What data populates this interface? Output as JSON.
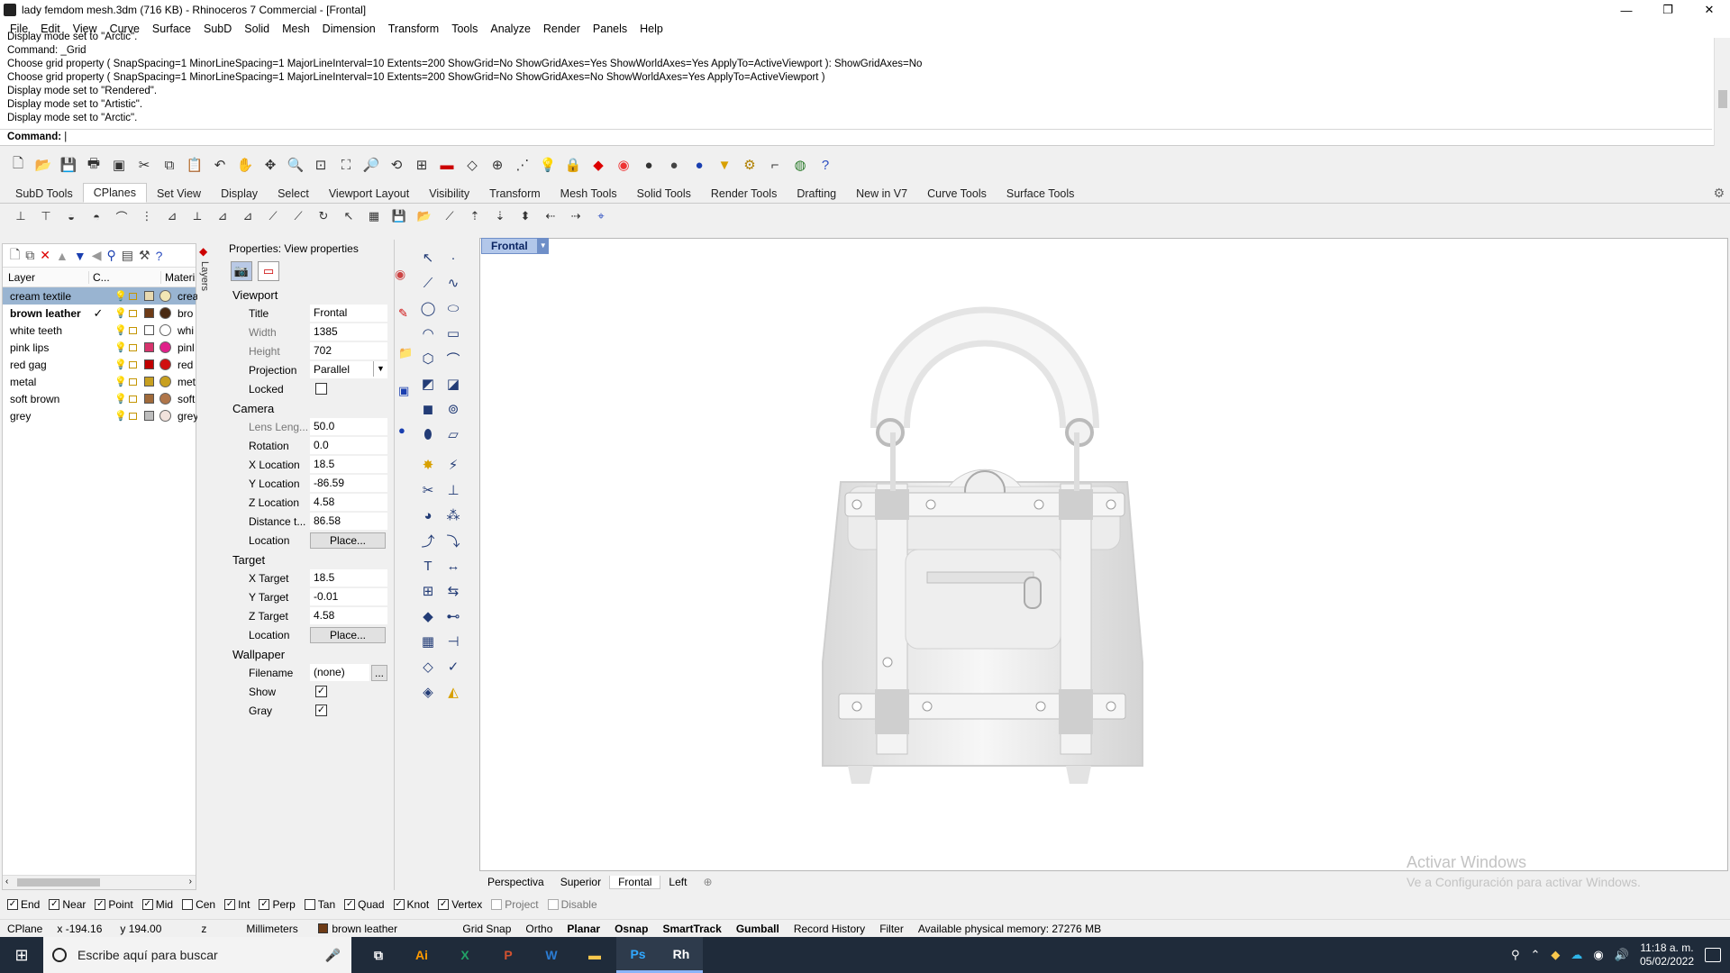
{
  "window": {
    "title": "lady femdom mesh.3dm (716 KB) - Rhinoceros 7 Commercial - [Frontal]",
    "minimize": "—",
    "restore": "❐",
    "close": "✕"
  },
  "menu": [
    "File",
    "Edit",
    "View",
    "Curve",
    "Surface",
    "SubD",
    "Solid",
    "Mesh",
    "Dimension",
    "Transform",
    "Tools",
    "Analyze",
    "Render",
    "Panels",
    "Help"
  ],
  "command_history": [
    "Display mode set to \"Arctic\".",
    "Command: _Grid",
    "Choose grid property ( SnapSpacing=1  MinorLineSpacing=1  MajorLineInterval=10  Extents=200  ShowGrid=No  ShowGridAxes=Yes  ShowWorldAxes=Yes  ApplyTo=ActiveViewport ): ShowGridAxes=No",
    "Choose grid property ( SnapSpacing=1  MinorLineSpacing=1  MajorLineInterval=10  Extents=200  ShowGrid=No  ShowGridAxes=No  ShowWorldAxes=Yes  ApplyTo=ActiveViewport )",
    "Display mode set to \"Rendered\".",
    "Display mode set to \"Artistic\".",
    "Display mode set to \"Arctic\"."
  ],
  "command_prompt": "Command:",
  "toolbar_tabs": [
    {
      "label": "SubD Tools"
    },
    {
      "label": "CPlanes"
    },
    {
      "label": "Set View"
    },
    {
      "label": "Display"
    },
    {
      "label": "Select"
    },
    {
      "label": "Viewport Layout"
    },
    {
      "label": "Visibility"
    },
    {
      "label": "Transform"
    },
    {
      "label": "Mesh Tools"
    },
    {
      "label": "Solid Tools"
    },
    {
      "label": "Render Tools"
    },
    {
      "label": "Drafting"
    },
    {
      "label": "New in V7"
    },
    {
      "label": "Curve Tools"
    },
    {
      "label": "Surface Tools"
    }
  ],
  "layers": {
    "col_layer": "Layer",
    "col_current": "C...",
    "col_material": "Materi",
    "rows": [
      {
        "name": "cream textile",
        "color": "#e8d9b0",
        "mat": "#f2e7b4",
        "matname": "crea",
        "selected": true
      },
      {
        "name": "brown leather",
        "color": "#6e3b16",
        "mat": "#4a2a12",
        "matname": "bro",
        "current": true
      },
      {
        "name": "white teeth",
        "color": "#ffffff",
        "mat": "#ffffff",
        "matname": "whi"
      },
      {
        "name": "pink lips",
        "color": "#d6336c",
        "mat": "#e0208a",
        "matname": "pinl"
      },
      {
        "name": "red gag",
        "color": "#c00000",
        "mat": "#d01010",
        "matname": "red"
      },
      {
        "name": "metal",
        "color": "#c8a020",
        "mat": "#c8a020",
        "matname": "met"
      },
      {
        "name": "soft brown",
        "color": "#a06a3a",
        "mat": "#b0764a",
        "matname": "soft"
      },
      {
        "name": "grey",
        "color": "#bdbdbd",
        "mat": "#f1e2dc",
        "matname": "grey"
      }
    ],
    "tab_label": "Layers"
  },
  "properties": {
    "header": "Properties: View properties",
    "viewport_section": "Viewport",
    "title_k": "Title",
    "title_v": "Frontal",
    "width_k": "Width",
    "width_v": "1385",
    "height_k": "Height",
    "height_v": "702",
    "projection_k": "Projection",
    "projection_v": "Parallel",
    "locked_k": "Locked",
    "camera_section": "Camera",
    "lens_k": "Lens Leng...",
    "lens_v": "50.0",
    "rotation_k": "Rotation",
    "rotation_v": "0.0",
    "xloc_k": "X Location",
    "xloc_v": "18.5",
    "yloc_k": "Y Location",
    "yloc_v": "-86.59",
    "zloc_k": "Z Location",
    "zloc_v": "4.58",
    "dist_k": "Distance t...",
    "dist_v": "86.58",
    "location_k": "Location",
    "place_btn": "Place...",
    "target_section": "Target",
    "xt_k": "X Target",
    "xt_v": "18.5",
    "yt_k": "Y Target",
    "yt_v": "-0.01",
    "zt_k": "Z Target",
    "zt_v": "4.58",
    "tloc_k": "Location",
    "tplace_btn": "Place...",
    "wallpaper_section": "Wallpaper",
    "filename_k": "Filename",
    "filename_v": "(none)",
    "browse_btn": "...",
    "show_k": "Show",
    "gray_k": "Gray"
  },
  "viewport": {
    "active_tab": "Frontal",
    "tabs": [
      "Perspectiva",
      "Superior",
      "Frontal",
      "Left"
    ],
    "watermark_1": "Activar Windows",
    "watermark_2": "Ve a Configuración para activar Windows."
  },
  "osnaps": [
    {
      "label": "End",
      "on": true
    },
    {
      "label": "Near",
      "on": true
    },
    {
      "label": "Point",
      "on": true
    },
    {
      "label": "Mid",
      "on": true
    },
    {
      "label": "Cen",
      "on": false
    },
    {
      "label": "Int",
      "on": true
    },
    {
      "label": "Perp",
      "on": true
    },
    {
      "label": "Tan",
      "on": false
    },
    {
      "label": "Quad",
      "on": true
    },
    {
      "label": "Knot",
      "on": true
    },
    {
      "label": "Vertex",
      "on": true
    },
    {
      "label": "Project",
      "on": false
    },
    {
      "label": "Disable",
      "on": false
    }
  ],
  "status": {
    "cplane": "CPlane",
    "x": "x -194.16",
    "y": "y 194.00",
    "z": "z",
    "units": "Millimeters",
    "layer": "brown leather",
    "gridsnap": "Grid Snap",
    "ortho": "Ortho",
    "planar": "Planar",
    "osnap": "Osnap",
    "smarttrack": "SmartTrack",
    "gumball": "Gumball",
    "history": "Record History",
    "filter": "Filter",
    "memory": "Available physical memory: 27276 MB"
  },
  "taskbar": {
    "search_placeholder": "Escribe aquí para buscar",
    "apps": [
      "Ai",
      "X",
      "P",
      "W",
      "▬",
      "Ps",
      "Rh"
    ],
    "time": "11:18 a. m.",
    "date": "05/02/2022"
  }
}
